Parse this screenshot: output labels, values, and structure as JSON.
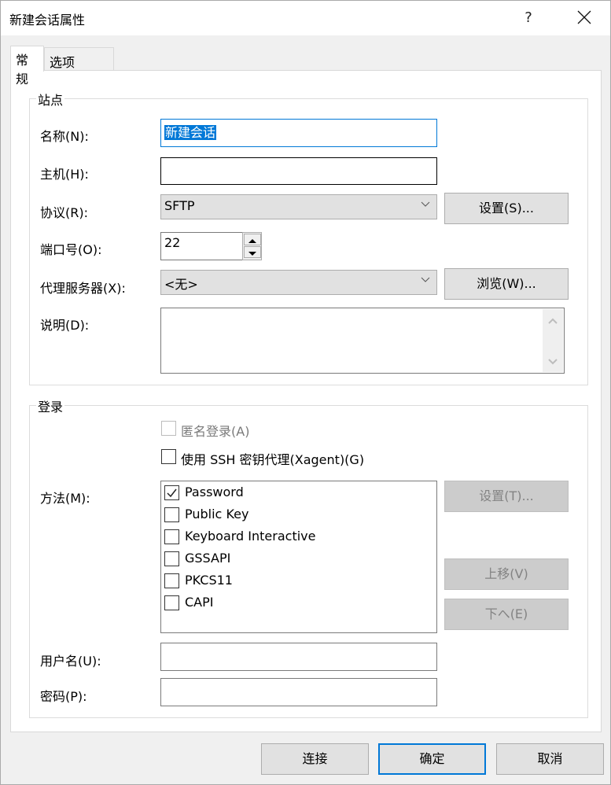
{
  "window": {
    "title": "新建会话属性",
    "help_label": "?",
    "close_icon": "close-icon"
  },
  "tabs": [
    {
      "label": "常规",
      "active": true
    },
    {
      "label": "选项",
      "active": false
    }
  ],
  "site": {
    "group_title": "站点",
    "name_label": "名称(N):",
    "name_value": "新建会话",
    "host_label": "主机(H):",
    "host_value": "",
    "protocol_label": "协议(R):",
    "protocol_value": "SFTP",
    "protocol_settings_button": "设置(S)...",
    "port_label": "端口号(O):",
    "port_value": "22",
    "proxy_label": "代理服务器(X):",
    "proxy_value": "<无>",
    "proxy_browse_button": "浏览(W)...",
    "description_label": "说明(D):",
    "description_value": ""
  },
  "login": {
    "group_title": "登录",
    "anonymous_label": "匿名登录(A)",
    "anonymous_checked": false,
    "anonymous_enabled": false,
    "xagent_label": "使用 SSH 密钥代理(Xagent)(G)",
    "xagent_checked": false,
    "method_label": "方法(M):",
    "methods": [
      {
        "label": "Password",
        "checked": true
      },
      {
        "label": "Public Key",
        "checked": false
      },
      {
        "label": "Keyboard Interactive",
        "checked": false
      },
      {
        "label": "GSSAPI",
        "checked": false
      },
      {
        "label": "PKCS11",
        "checked": false
      },
      {
        "label": "CAPI",
        "checked": false
      }
    ],
    "method_settings_button": "设置(T)...",
    "move_up_button": "上移(V)",
    "move_down_button": "下へ(E)",
    "username_label": "用户名(U):",
    "username_value": "",
    "password_label": "密码(P):",
    "password_value": ""
  },
  "footer": {
    "connect_button": "连接",
    "ok_button": "确定",
    "cancel_button": "取消"
  },
  "colors": {
    "accent": "#0078d7",
    "button_bg": "#e1e1e1",
    "disabled_button_bg": "#cccccc"
  }
}
